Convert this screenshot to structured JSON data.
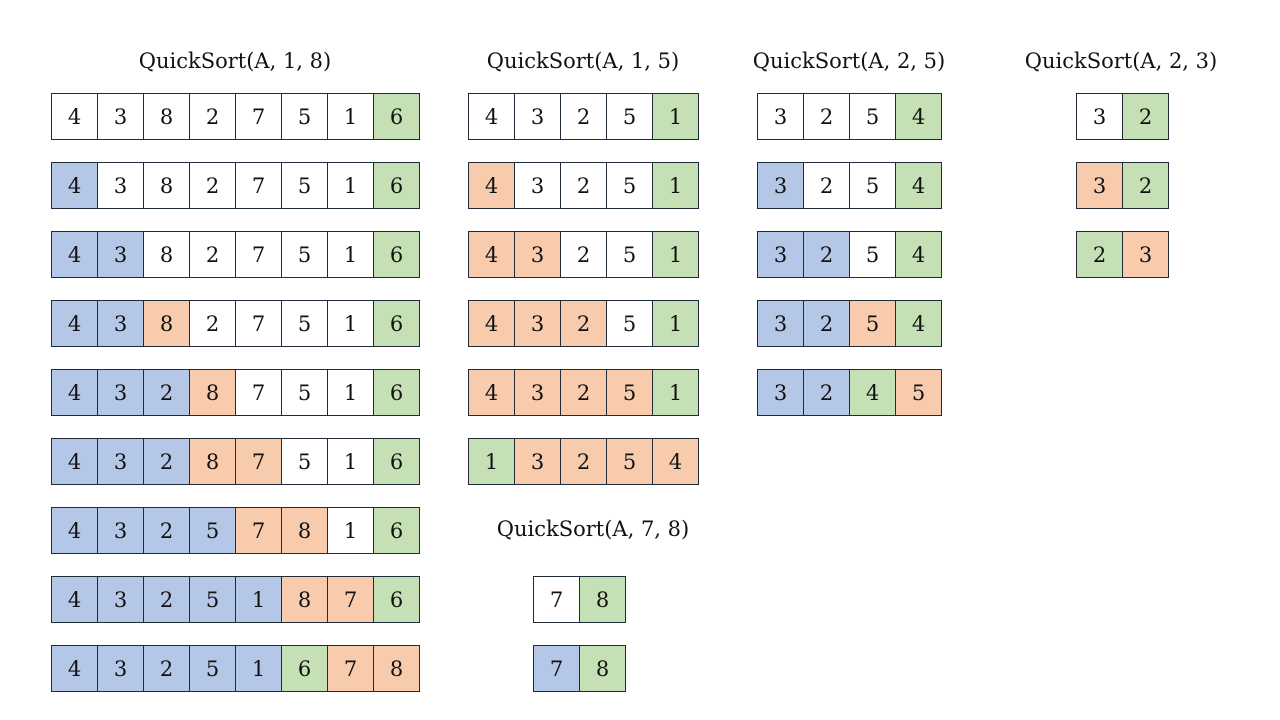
{
  "colors": {
    "W": "#ffffff",
    "B": "#b4c7e7",
    "O": "#f8cbad",
    "G": "#c5e0b4",
    "border": "#1f2b38"
  },
  "groups": [
    {
      "title": "QuickSort(A, 1, 8)",
      "rows": [
        {
          "values": [
            "4",
            "3",
            "8",
            "2",
            "7",
            "5",
            "1",
            "6"
          ],
          "colors": [
            "W",
            "W",
            "W",
            "W",
            "W",
            "W",
            "W",
            "G"
          ]
        },
        {
          "values": [
            "4",
            "3",
            "8",
            "2",
            "7",
            "5",
            "1",
            "6"
          ],
          "colors": [
            "B",
            "W",
            "W",
            "W",
            "W",
            "W",
            "W",
            "G"
          ]
        },
        {
          "values": [
            "4",
            "3",
            "8",
            "2",
            "7",
            "5",
            "1",
            "6"
          ],
          "colors": [
            "B",
            "B",
            "W",
            "W",
            "W",
            "W",
            "W",
            "G"
          ]
        },
        {
          "values": [
            "4",
            "3",
            "8",
            "2",
            "7",
            "5",
            "1",
            "6"
          ],
          "colors": [
            "B",
            "B",
            "O",
            "W",
            "W",
            "W",
            "W",
            "G"
          ]
        },
        {
          "values": [
            "4",
            "3",
            "2",
            "8",
            "7",
            "5",
            "1",
            "6"
          ],
          "colors": [
            "B",
            "B",
            "B",
            "O",
            "W",
            "W",
            "W",
            "G"
          ]
        },
        {
          "values": [
            "4",
            "3",
            "2",
            "8",
            "7",
            "5",
            "1",
            "6"
          ],
          "colors": [
            "B",
            "B",
            "B",
            "O",
            "O",
            "W",
            "W",
            "G"
          ]
        },
        {
          "values": [
            "4",
            "3",
            "2",
            "5",
            "7",
            "8",
            "1",
            "6"
          ],
          "colors": [
            "B",
            "B",
            "B",
            "B",
            "O",
            "O",
            "W",
            "G"
          ]
        },
        {
          "values": [
            "4",
            "3",
            "2",
            "5",
            "1",
            "8",
            "7",
            "6"
          ],
          "colors": [
            "B",
            "B",
            "B",
            "B",
            "B",
            "O",
            "O",
            "G"
          ]
        },
        {
          "values": [
            "4",
            "3",
            "2",
            "5",
            "1",
            "6",
            "7",
            "8"
          ],
          "colors": [
            "B",
            "B",
            "B",
            "B",
            "B",
            "G",
            "O",
            "O"
          ]
        }
      ]
    },
    {
      "title": "QuickSort(A, 1, 5)",
      "rows": [
        {
          "values": [
            "4",
            "3",
            "2",
            "5",
            "1"
          ],
          "colors": [
            "W",
            "W",
            "W",
            "W",
            "G"
          ]
        },
        {
          "values": [
            "4",
            "3",
            "2",
            "5",
            "1"
          ],
          "colors": [
            "O",
            "W",
            "W",
            "W",
            "G"
          ]
        },
        {
          "values": [
            "4",
            "3",
            "2",
            "5",
            "1"
          ],
          "colors": [
            "O",
            "O",
            "W",
            "W",
            "G"
          ]
        },
        {
          "values": [
            "4",
            "3",
            "2",
            "5",
            "1"
          ],
          "colors": [
            "O",
            "O",
            "O",
            "W",
            "G"
          ]
        },
        {
          "values": [
            "4",
            "3",
            "2",
            "5",
            "1"
          ],
          "colors": [
            "O",
            "O",
            "O",
            "O",
            "G"
          ]
        },
        {
          "values": [
            "1",
            "3",
            "2",
            "5",
            "4"
          ],
          "colors": [
            "G",
            "O",
            "O",
            "O",
            "O"
          ]
        }
      ]
    },
    {
      "title": "QuickSort(A, 2, 5)",
      "rows": [
        {
          "values": [
            "3",
            "2",
            "5",
            "4"
          ],
          "colors": [
            "W",
            "W",
            "W",
            "G"
          ]
        },
        {
          "values": [
            "3",
            "2",
            "5",
            "4"
          ],
          "colors": [
            "B",
            "W",
            "W",
            "G"
          ]
        },
        {
          "values": [
            "3",
            "2",
            "5",
            "4"
          ],
          "colors": [
            "B",
            "B",
            "W",
            "G"
          ]
        },
        {
          "values": [
            "3",
            "2",
            "5",
            "4"
          ],
          "colors": [
            "B",
            "B",
            "O",
            "G"
          ]
        },
        {
          "values": [
            "3",
            "2",
            "4",
            "5"
          ],
          "colors": [
            "B",
            "B",
            "G",
            "O"
          ]
        }
      ]
    },
    {
      "title": "QuickSort(A, 2, 3)",
      "rows": [
        {
          "values": [
            "3",
            "2"
          ],
          "colors": [
            "W",
            "G"
          ]
        },
        {
          "values": [
            "3",
            "2"
          ],
          "colors": [
            "O",
            "G"
          ]
        },
        {
          "values": [
            "2",
            "3"
          ],
          "colors": [
            "G",
            "O"
          ]
        }
      ]
    },
    {
      "title": "QuickSort(A, 7, 8)",
      "rows": [
        {
          "values": [
            "7",
            "8"
          ],
          "colors": [
            "W",
            "G"
          ]
        },
        {
          "values": [
            "7",
            "8"
          ],
          "colors": [
            "B",
            "G"
          ]
        }
      ]
    }
  ]
}
